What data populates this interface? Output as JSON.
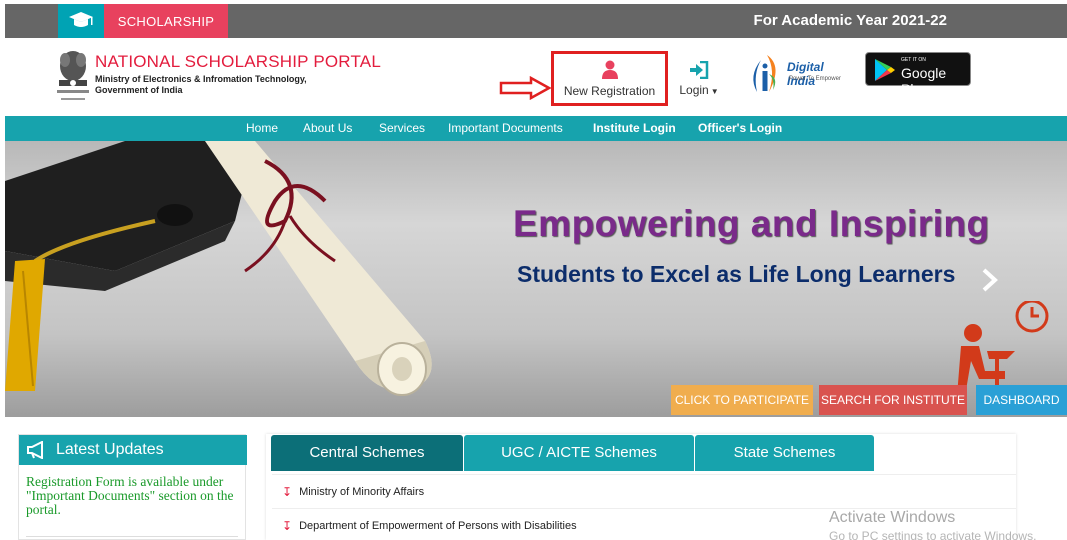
{
  "topbar": {
    "scholarship_label": "SCHOLARSHIP",
    "academic_year": "For Academic Year 2021-22"
  },
  "header": {
    "title": "NATIONAL SCHOLARSHIP PORTAL",
    "subtitle_line1": "Ministry of Electronics & Infromation Technology,",
    "subtitle_line2": "Government of India",
    "new_registration": "New Registration",
    "login": "Login",
    "digital_india": "Digital India",
    "digital_india_tagline": "Power To Empower",
    "google_play_small": "GET IT ON",
    "google_play": "Google Play"
  },
  "nav": {
    "items": [
      "Home",
      "About Us",
      "Services",
      "Important Documents",
      "Institute Login",
      "Officer's Login"
    ]
  },
  "banner": {
    "headline": "Empowering and Inspiring",
    "subheadline": "Students to Excel as Life Long Learners",
    "buttons": [
      "CLICK TO PARTICIPATE",
      "SEARCH FOR INSTITUTE",
      "DASHBOARD"
    ]
  },
  "latest_updates": {
    "title": "Latest Updates",
    "text": "Registration Form is available under \"Important Documents\" section on the portal."
  },
  "schemes": {
    "tabs": [
      "Central Schemes",
      "UGC / AICTE Schemes",
      "State Schemes"
    ],
    "rows": [
      "Ministry of Minority Affairs",
      "Department of Empowerment of Persons with Disabilities"
    ]
  },
  "watermark": {
    "line1": "Activate Windows",
    "line2": "Go to PC settings to activate Windows."
  },
  "colors": {
    "teal": "#17a3ad",
    "dark_teal": "#0c6f78",
    "red": "#e31c3d",
    "orange": "#f0ad4e",
    "blue": "#2aa0d6"
  }
}
